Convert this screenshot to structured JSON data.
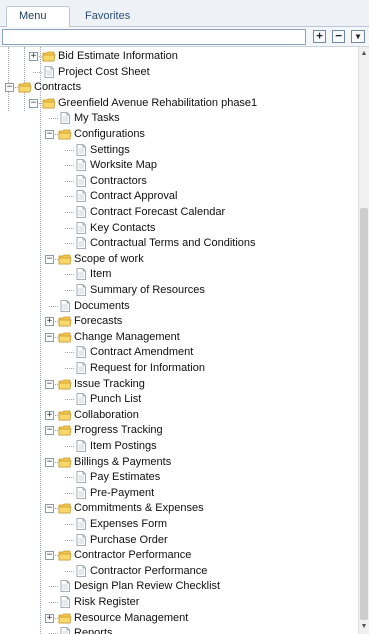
{
  "tabs": [
    {
      "label": "Menu",
      "active": true
    },
    {
      "label": "Favorites",
      "active": false
    }
  ],
  "search": {
    "value": "",
    "placeholder": ""
  },
  "search_buttons": [
    {
      "icon": "expand-all-icon",
      "glyph": "+"
    },
    {
      "icon": "collapse-all-icon",
      "glyph": "−"
    },
    {
      "icon": "chevron-down-icon",
      "glyph": "▼"
    }
  ],
  "scrollbar": {
    "up_glyph": "▲",
    "down_glyph": "▼"
  },
  "tree": [
    {
      "label": "Bid Estimate Information",
      "type": "folder",
      "level": 1,
      "toggle": "+"
    },
    {
      "label": "Project Cost Sheet",
      "type": "doc",
      "level": 1
    },
    {
      "label": "Contracts",
      "type": "folder",
      "level": 0,
      "toggle": "−"
    },
    {
      "label": "Greenfield Avenue Rehabilitation phase1",
      "type": "folder",
      "level": 1,
      "toggle": "−"
    },
    {
      "label": "My Tasks",
      "type": "doc",
      "level": 2
    },
    {
      "label": "Configurations",
      "type": "folder",
      "level": 2,
      "toggle": "−"
    },
    {
      "label": "Settings",
      "type": "doc",
      "level": 3
    },
    {
      "label": "Worksite Map",
      "type": "doc",
      "level": 3
    },
    {
      "label": "Contractors",
      "type": "doc",
      "level": 3
    },
    {
      "label": "Contract Approval",
      "type": "doc",
      "level": 3
    },
    {
      "label": "Contract Forecast Calendar",
      "type": "doc",
      "level": 3
    },
    {
      "label": "Key Contacts",
      "type": "doc",
      "level": 3
    },
    {
      "label": "Contractual Terms and Conditions",
      "type": "doc",
      "level": 3
    },
    {
      "label": "Scope of work",
      "type": "folder",
      "level": 2,
      "toggle": "−"
    },
    {
      "label": "Item",
      "type": "doc",
      "level": 3
    },
    {
      "label": "Summary of Resources",
      "type": "doc",
      "level": 3
    },
    {
      "label": "Documents",
      "type": "doc",
      "level": 2
    },
    {
      "label": "Forecasts",
      "type": "folder",
      "level": 2,
      "toggle": "+"
    },
    {
      "label": "Change Management",
      "type": "folder",
      "level": 2,
      "toggle": "−"
    },
    {
      "label": "Contract Amendment",
      "type": "doc",
      "level": 3
    },
    {
      "label": "Request for Information",
      "type": "doc",
      "level": 3
    },
    {
      "label": "Issue Tracking",
      "type": "folder",
      "level": 2,
      "toggle": "−"
    },
    {
      "label": "Punch List",
      "type": "doc",
      "level": 3
    },
    {
      "label": "Collaboration",
      "type": "folder",
      "level": 2,
      "toggle": "+"
    },
    {
      "label": "Progress Tracking",
      "type": "folder",
      "level": 2,
      "toggle": "−"
    },
    {
      "label": "Item Postings",
      "type": "doc",
      "level": 3
    },
    {
      "label": "Billings & Payments",
      "type": "folder",
      "level": 2,
      "toggle": "−"
    },
    {
      "label": "Pay Estimates",
      "type": "doc",
      "level": 3
    },
    {
      "label": "Pre-Payment",
      "type": "doc",
      "level": 3
    },
    {
      "label": "Commitments & Expenses",
      "type": "folder",
      "level": 2,
      "toggle": "−"
    },
    {
      "label": "Expenses Form",
      "type": "doc",
      "level": 3
    },
    {
      "label": "Purchase Order",
      "type": "doc",
      "level": 3
    },
    {
      "label": "Contractor Performance",
      "type": "folder",
      "level": 2,
      "toggle": "−"
    },
    {
      "label": "Contractor Performance",
      "type": "doc",
      "level": 3
    },
    {
      "label": "Design Plan Review Checklist",
      "type": "doc",
      "level": 2
    },
    {
      "label": "Risk Register",
      "type": "doc",
      "level": 2
    },
    {
      "label": "Resource Management",
      "type": "folder",
      "level": 2,
      "toggle": "+"
    },
    {
      "label": "Reports",
      "type": "doc",
      "level": 2
    }
  ],
  "colors": {
    "folder": "#f3c74b",
    "folder_dark": "#c9962b",
    "doc": "#ffffff",
    "tab_text": "#2b4f78"
  }
}
